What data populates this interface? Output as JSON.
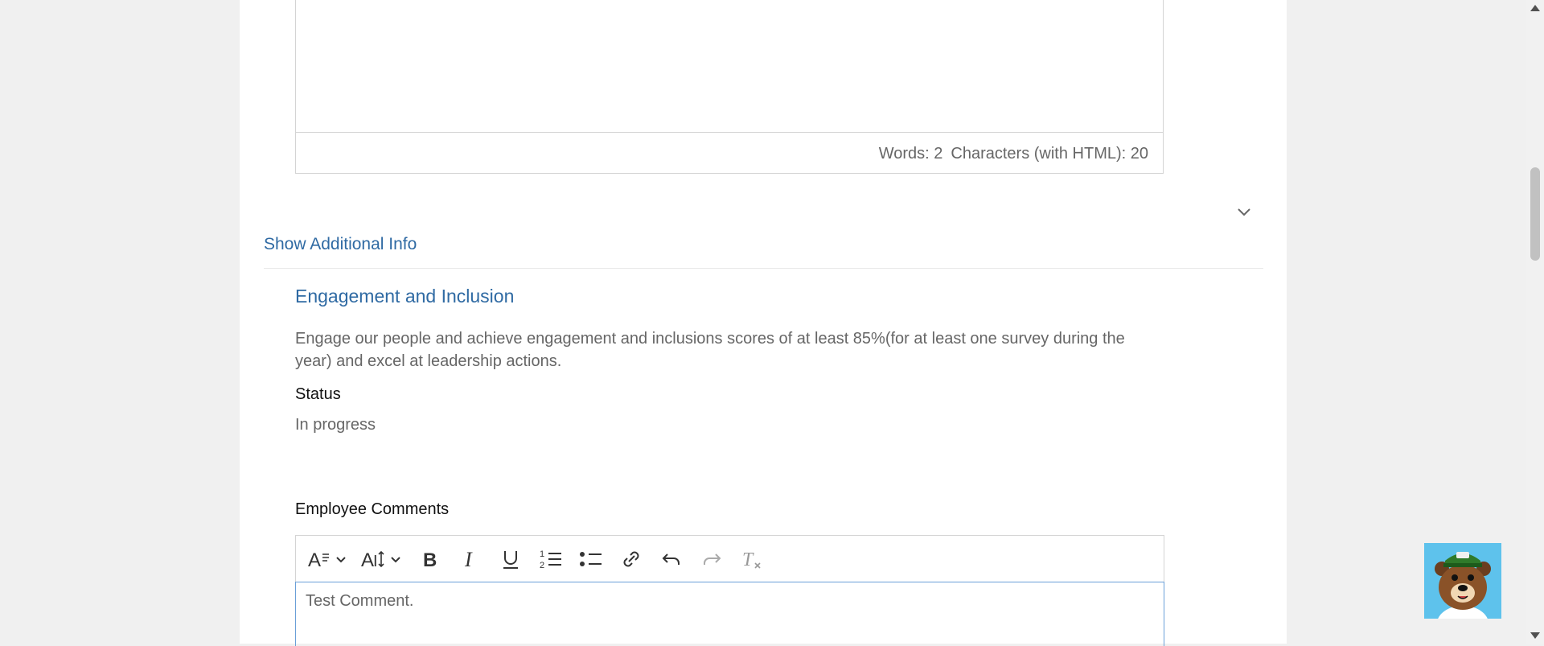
{
  "editor_top": {
    "words_label": "Words: 2",
    "characters_label": "Characters (with HTML): 20"
  },
  "toggle": {
    "label": "Show Additional Info",
    "chevron_icon": "chevron-down-icon"
  },
  "goal": {
    "title": "Engagement and Inclusion",
    "description": "Engage our people and achieve engagement and inclusions scores of at least 85%(for at least one survey during the year) and excel at leadership actions.",
    "status_label": "Status",
    "status_value": "In progress"
  },
  "comments": {
    "label": "Employee Comments",
    "value": "Test Comment.",
    "toolbar": [
      {
        "name": "font-style-button",
        "icon": "font-style-icon"
      },
      {
        "name": "font-size-button",
        "icon": "font-size-icon"
      },
      {
        "name": "bold-button",
        "icon": "bold-icon"
      },
      {
        "name": "italic-button",
        "icon": "italic-icon"
      },
      {
        "name": "underline-button",
        "icon": "underline-icon"
      },
      {
        "name": "ordered-list-button",
        "icon": "ordered-list-icon"
      },
      {
        "name": "bullet-list-button",
        "icon": "bullet-list-icon"
      },
      {
        "name": "link-button",
        "icon": "link-icon"
      },
      {
        "name": "undo-button",
        "icon": "undo-icon"
      },
      {
        "name": "redo-button",
        "icon": "redo-icon"
      },
      {
        "name": "clear-format-button",
        "icon": "clear-format-icon"
      }
    ]
  },
  "colors": {
    "accent": "#2f6aa3",
    "chat_bg": "#5ec2ec"
  },
  "chat_widget": {
    "icon": "bear-mascot-icon"
  }
}
